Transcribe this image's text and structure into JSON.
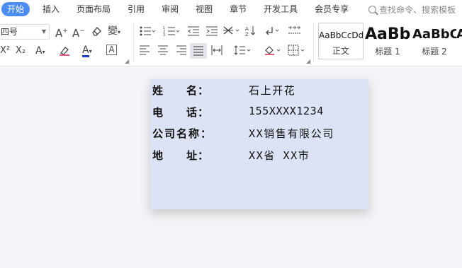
{
  "menu": {
    "items": [
      "开始",
      "插入",
      "页面布局",
      "引用",
      "审阅",
      "视图",
      "章节",
      "开发工具",
      "会员专享"
    ],
    "search_placeholder": "查找命令、搜索模板"
  },
  "ribbon": {
    "font_size": "四号",
    "icons": {
      "grow_font": "A⁺",
      "shrink_font": "A⁻",
      "clear_format": "eraser",
      "phonetic": "wén",
      "superscript": "X²",
      "subscript": "X₂",
      "text_effect": "A",
      "highlight": "highlighter",
      "font_color": "A",
      "char_border": "A"
    },
    "styles": [
      {
        "sample": "AaBbCcDd",
        "name": "正文"
      },
      {
        "sample": "AaBb",
        "name": "标题 1"
      },
      {
        "sample": "AaBbC",
        "name": "标题 2"
      },
      {
        "sample": "A",
        "name": ""
      }
    ],
    "font_color_hex": "#1f3fbf"
  },
  "document": {
    "rows": [
      {
        "label": "姓　　名：",
        "value": "石上开花"
      },
      {
        "label": "电　　话：",
        "value": "155XXXX1234"
      },
      {
        "label": "公司名称：",
        "value": "XX销售有限公司"
      },
      {
        "label": "地　　址：",
        "value": "XX省 XX市"
      }
    ],
    "card_color": "#dce3f4"
  }
}
